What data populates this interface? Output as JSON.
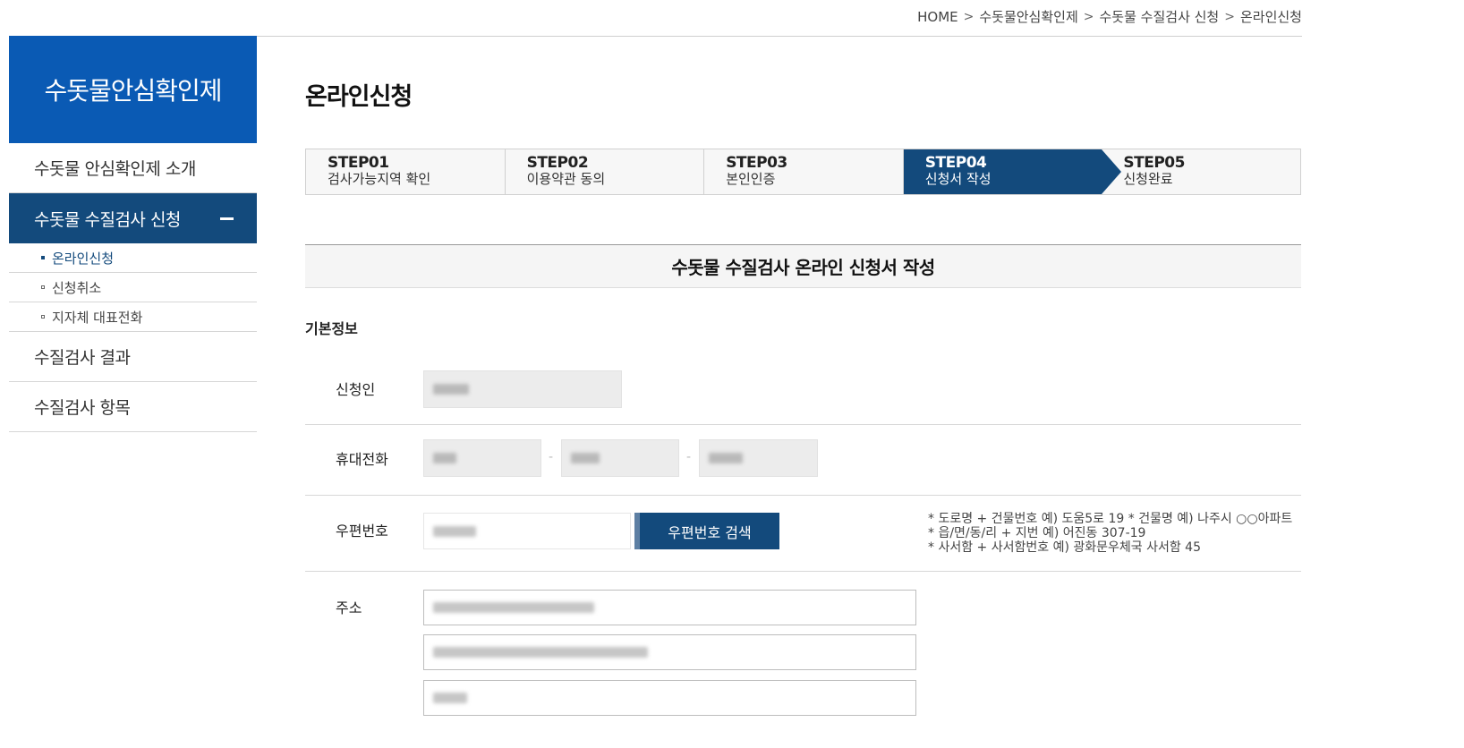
{
  "breadcrumb": {
    "items": [
      "HOME",
      "수돗물안심확인제",
      "수돗물 수질검사 신청",
      "온라인신청"
    ],
    "separator": ">"
  },
  "sidebar": {
    "title": "수돗물안심확인제",
    "items": [
      {
        "label": "수돗물 안심확인제 소개"
      },
      {
        "label": "수돗물 수질검사 신청"
      },
      {
        "label": "수질검사 결과"
      },
      {
        "label": "수질검사 항목"
      }
    ],
    "subitems": [
      {
        "label": "온라인신청"
      },
      {
        "label": "신청취소"
      },
      {
        "label": "지자체 대표전화"
      }
    ]
  },
  "page": {
    "title": "온라인신청"
  },
  "steps": [
    {
      "num": "STEP01",
      "label": "검사가능지역 확인"
    },
    {
      "num": "STEP02",
      "label": "이용약관 동의"
    },
    {
      "num": "STEP03",
      "label": "본인인증"
    },
    {
      "num": "STEP04",
      "label": "신청서 작성"
    },
    {
      "num": "STEP05",
      "label": "신청완료"
    }
  ],
  "form": {
    "title": "수돗물 수질검사 온라인 신청서 작성",
    "section": "기본정보",
    "labels": {
      "applicant": "신청인",
      "phone": "휴대전화",
      "zipcode": "우편번호",
      "address": "주소"
    },
    "phone_separator": "-",
    "zip_button": "우편번호 검색",
    "help_lines": [
      "* 도로명 + 건물번호 예) 도움5로 19 * 건물명 예) 나주시 ○○아파트",
      "* 읍/면/동/리 + 지번 예) 어진동 307-19",
      "* 사서함 + 사서함번호 예) 광화문우체국 사서함 45"
    ]
  },
  "colors": {
    "brand_blue": "#0a5ab4",
    "navy": "#134a7c"
  }
}
